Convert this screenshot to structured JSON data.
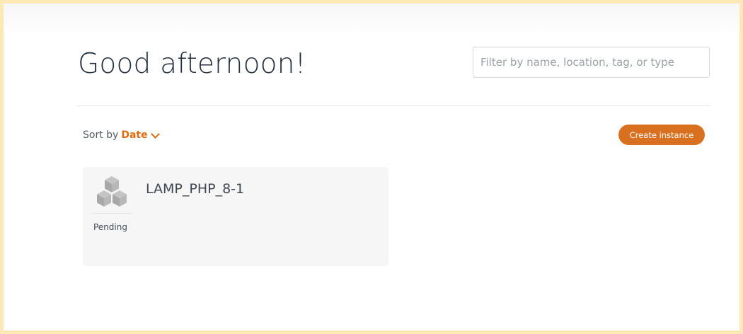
{
  "greeting": "Good afternoon!",
  "filter": {
    "placeholder": "Filter by name, location, tag, or type",
    "value": ""
  },
  "sort": {
    "label": "Sort by",
    "value": "Date"
  },
  "create_button": {
    "label": "Create instance"
  },
  "instances": [
    {
      "name": "LAMP_PHP_8-1",
      "status": "Pending",
      "icon": "instance-cubes-icon"
    }
  ],
  "colors": {
    "accent": "#dd6b10",
    "button": "#d9701f",
    "frame_border": "#fde9b8",
    "card_background": "#f6f6f6"
  }
}
